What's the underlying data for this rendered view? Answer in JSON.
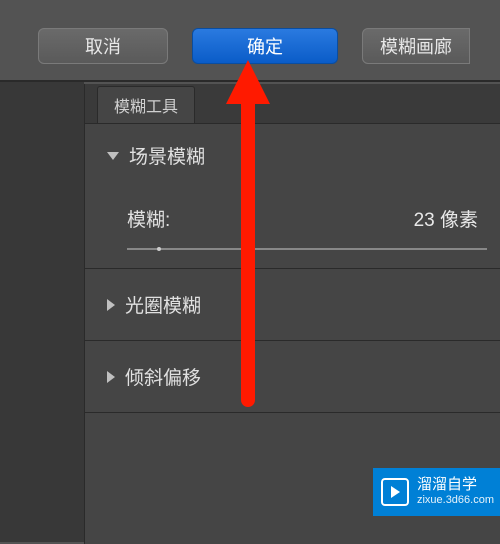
{
  "toolbar": {
    "cancel_label": "取消",
    "ok_label": "确定",
    "gallery_label": "模糊画廊"
  },
  "panel": {
    "tab_label": "模糊工具",
    "sections": {
      "field_blur": {
        "title": "场景模糊",
        "slider_label": "模糊:",
        "slider_value": "23 像素"
      },
      "iris_blur": {
        "title": "光圈模糊"
      },
      "tilt_shift": {
        "title": "倾斜偏移"
      }
    }
  },
  "watermark": {
    "brand": "溜溜自学",
    "url": "zixue.3d66.com"
  }
}
